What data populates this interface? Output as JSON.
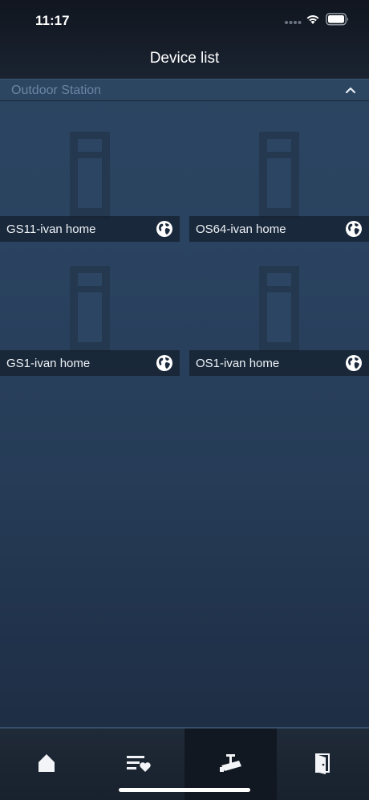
{
  "status_bar": {
    "time": "11:17"
  },
  "header": {
    "title": "Device list"
  },
  "section": {
    "title": "Outdoor Station",
    "expanded": true
  },
  "devices": [
    {
      "name": "GS11-ivan home",
      "icon": "globe-icon"
    },
    {
      "name": "OS64-ivan home",
      "icon": "globe-icon"
    },
    {
      "name": "GS1-ivan home",
      "icon": "globe-icon"
    },
    {
      "name": "OS1-ivan home",
      "icon": "globe-icon"
    }
  ],
  "tabbar": {
    "tabs": [
      {
        "icon": "home-icon"
      },
      {
        "icon": "favorites-list-icon"
      },
      {
        "icon": "camera-icon",
        "active": true
      },
      {
        "icon": "door-icon"
      }
    ]
  },
  "colors": {
    "background": "#2a4360",
    "header": "#141b26",
    "section_text": "#6a86a4",
    "tab_active": "#121821"
  }
}
